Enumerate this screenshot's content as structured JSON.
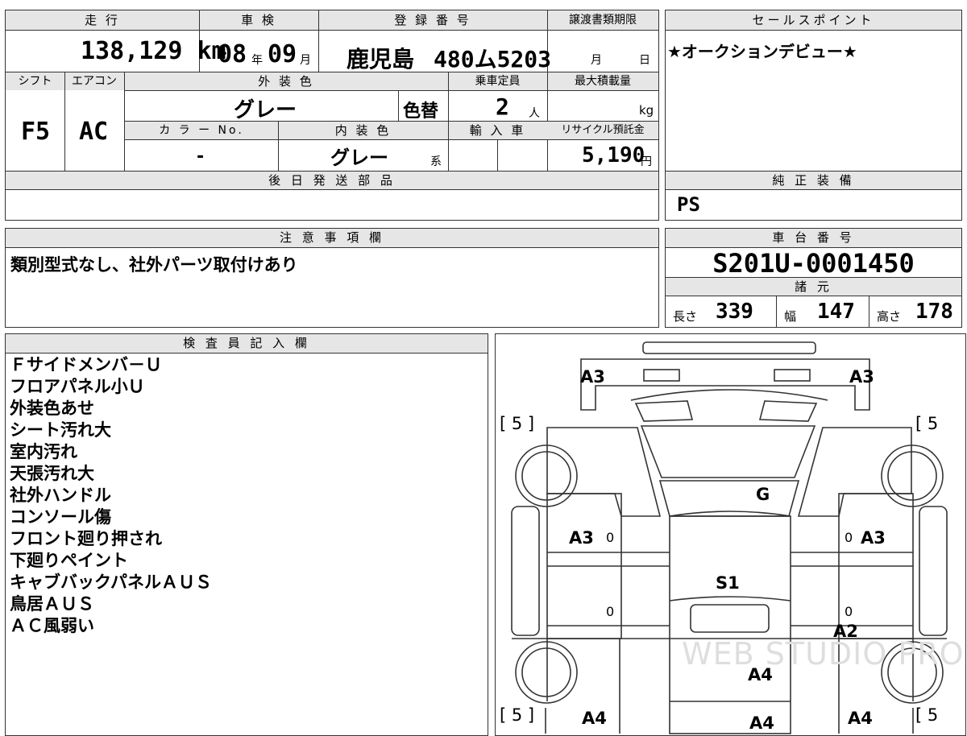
{
  "headers": {
    "mileage": "走 行",
    "inspection": "車 検",
    "registration": "登 録 番 号",
    "transfer_deadline": "譲渡書類期限",
    "sales_point": "セールスポイント",
    "shift": "シフト",
    "aircon": "エアコン",
    "exterior_color": "外 装 色",
    "capacity": "乗車定員",
    "max_load": "最大積載量",
    "color_no": "カ ラ ー No.",
    "interior_color": "内 装 色",
    "import_car": "輸 入 車",
    "recycle_fee": "リサイクル預託金",
    "deferred_parts": "後 日 発 送 部 品",
    "standard_equipment": "純 正 装 備",
    "notes": "注 意 事 項 欄",
    "chassis_number": "車 台 番 号",
    "specs": "諸 元",
    "inspector_notes": "検 査 員 記 入 欄"
  },
  "values": {
    "mileage": "138,129 km",
    "inspection_year": "08",
    "inspection_year_unit": "年",
    "inspection_month": "09",
    "inspection_month_unit": "月",
    "registration_region": "鹿児島",
    "registration_number": "480ム5203",
    "transfer_month_unit": "月",
    "transfer_day_unit": "日",
    "sales_point": "★オークションデビュー★",
    "shift": "F5",
    "aircon": "AC",
    "exterior_color": "グレー",
    "color_change": "色替",
    "capacity": "2",
    "capacity_unit": "人",
    "max_load_unit": "kg",
    "color_no": "-",
    "interior_color": "グレー",
    "interior_color_suffix": "系",
    "recycle_fee": "5,190",
    "recycle_fee_unit": "円",
    "standard_equipment": "PS",
    "notes": "類別型式なし、社外パーツ取付けあり",
    "chassis_number": "S201U-0001450",
    "length_label": "長さ",
    "length": "339",
    "width_label": "幅",
    "width": "147",
    "height_label": "高さ",
    "height": "178"
  },
  "inspector_items": [
    "Ｆサイドメンバ－Ｕ",
    "フロアパネル小Ｕ",
    "外装色あせ",
    "シート汚れ大",
    "室内汚れ",
    "天張汚れ大",
    "社外ハンドル",
    "コンソール傷",
    "フロント廻り押され",
    "下廻りペイント",
    "キャブバックパネルＡＵＳ",
    "鳥居ＡＵＳ",
    "ＡＣ風弱い"
  ],
  "diagram": {
    "marks": {
      "top_left": "A3",
      "top_right": "A3",
      "windshield": "G",
      "left_door": "A3",
      "right_door": "A3",
      "roof": "S1",
      "right_side": "A2",
      "bed_center": "A4",
      "bed_bottom": "A4",
      "bottom_left": "A4",
      "bottom_right": "A4",
      "zero_l1": "0",
      "zero_r1": "0",
      "zero_l2": "0",
      "zero_r2": "0"
    },
    "brackets": {
      "tl": "[ 5 ]",
      "tr": "[ 5",
      "bl": "[ 5 ]",
      "br": "[ 5"
    },
    "watermark": "WEB STUDIO PRO"
  }
}
